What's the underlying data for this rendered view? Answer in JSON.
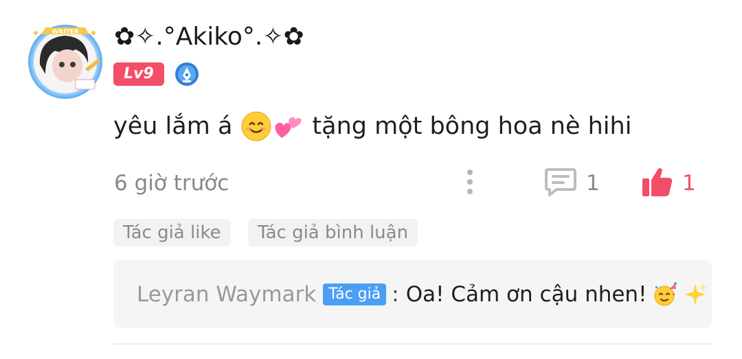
{
  "comment": {
    "username": "✿✧.°Akiko°.✧✿",
    "avatar_badge_text": "WRITER",
    "level": "Lv9",
    "text_before": "yêu lắm á",
    "text_after": "tặng một bông hoa nè hihi",
    "emojis": [
      "smiling-face-emoji",
      "two-hearts-emoji"
    ],
    "timestamp": "6 giờ trước",
    "reply_count": "1",
    "like_count": "1"
  },
  "tags": [
    "Tác giả like",
    "Tác giả bình luận"
  ],
  "reply": {
    "author": "Leyran Waymark",
    "author_tag": "Tác giả",
    "separator": ":",
    "content": "Oa! Cảm ơn cậu nhen!",
    "emojis": [
      "partying-face-emoji",
      "sparkles-emoji"
    ]
  },
  "colors": {
    "accent": "#f34d67",
    "author_tag": "#4a9ff5",
    "muted_text": "#888888"
  }
}
